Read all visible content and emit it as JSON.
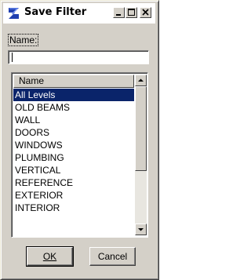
{
  "window": {
    "title": "Save Filter"
  },
  "form": {
    "name_label": "Name:",
    "name_value": ""
  },
  "list": {
    "header": "Name",
    "items": [
      "All Levels",
      "OLD BEAMS",
      "WALL",
      "DOORS",
      "WINDOWS",
      "PLUMBING",
      "VERTICAL",
      "REFERENCE",
      "EXTERIOR",
      "INTERIOR"
    ],
    "selected_index": 0
  },
  "buttons": {
    "ok_label": "OK",
    "cancel_label": "Cancel"
  },
  "colors": {
    "selection": "#0a246a",
    "dialog_face": "#d4d0c8"
  },
  "icons": {
    "app": "app-logo-icon",
    "minimize": "minimize-icon",
    "maximize": "maximize-icon",
    "close": "close-icon",
    "scroll_up": "arrow-up-icon",
    "scroll_down": "arrow-down-icon"
  }
}
